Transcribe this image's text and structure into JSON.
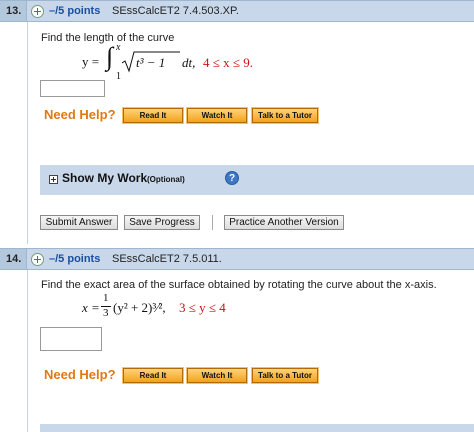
{
  "q13": {
    "number": "13.",
    "points": "–/5 points",
    "ref": "SEssCalcET2 7.4.503.XP.",
    "prompt": "Find the length of the curve",
    "eq_lhs": "y =",
    "int_upper": "x",
    "int_lower": "1",
    "integrand": "t³ − 1",
    "dt": "dt,",
    "range": "4 ≤ x ≤ 9."
  },
  "help": {
    "label": "Need Help?",
    "read": "Read It",
    "watch": "Watch It",
    "tutor": "Talk to a Tutor"
  },
  "work": {
    "title": "Show My Work",
    "optional": "(Optional)",
    "info": "?"
  },
  "actions": {
    "submit": "Submit Answer",
    "save": "Save Progress",
    "practice": "Practice Another Version"
  },
  "q14": {
    "number": "14.",
    "points": "–/5 points",
    "ref": "SEssCalcET2 7.5.011.",
    "prompt": "Find the exact area of the surface obtained by rotating the curve about the x-axis.",
    "eq_lhs": "x =",
    "frac_num": "1",
    "frac_den": "3",
    "expr": "(y² + 2)³⁄²,",
    "range": "3 ≤ y ≤ 4"
  },
  "colors": {
    "bar": "#c8d8ea",
    "points": "#1a4fa0",
    "help": "#e07a10",
    "range": "#cc1111"
  }
}
